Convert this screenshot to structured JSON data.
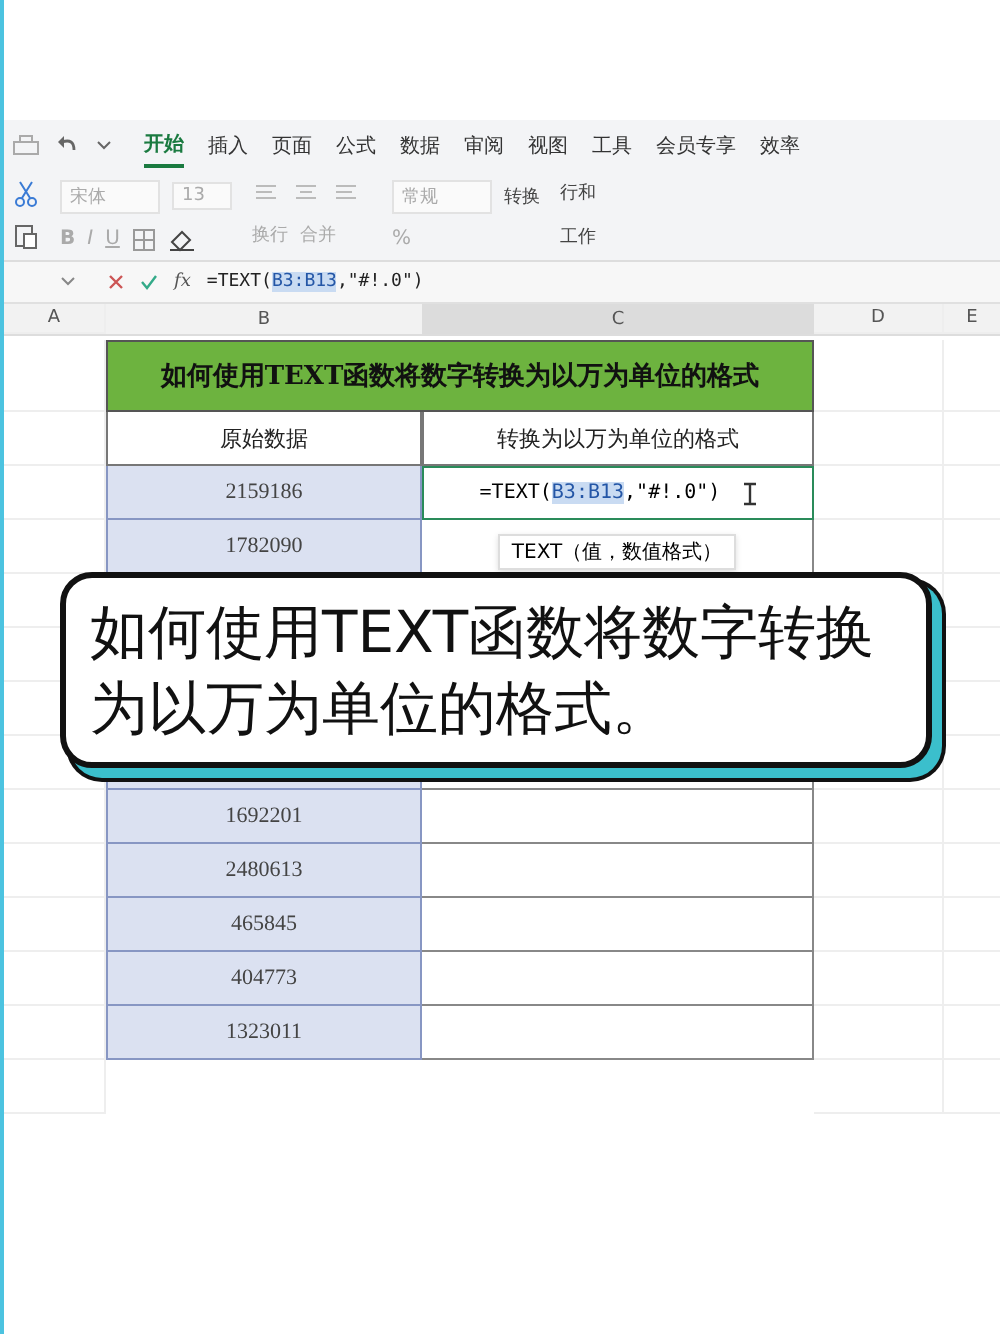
{
  "menu": {
    "tabs": [
      {
        "label": "开始",
        "selected": true
      },
      {
        "label": "插入",
        "selected": false
      },
      {
        "label": "页面",
        "selected": false
      },
      {
        "label": "公式",
        "selected": false
      },
      {
        "label": "数据",
        "selected": false
      },
      {
        "label": "审阅",
        "selected": false
      },
      {
        "label": "视图",
        "selected": false
      },
      {
        "label": "工具",
        "selected": false
      },
      {
        "label": "会员专享",
        "selected": false
      },
      {
        "label": "效率",
        "selected": false
      }
    ]
  },
  "ribbon": {
    "font": "宋体",
    "size": "13",
    "wrap": "换行",
    "merge": "合并",
    "format": "常规",
    "convert": "转换",
    "row_col": "行和",
    "sheet": "工作"
  },
  "text_style": {
    "bold": "B",
    "italic": "I",
    "underline": "U",
    "percent": "%"
  },
  "formula_bar": {
    "fx": "fx",
    "before": "=TEXT(",
    "ref": "B3:B13",
    "after": ",\"#!.0\")"
  },
  "columns": [
    "A",
    "B",
    "C",
    "D",
    "E"
  ],
  "table": {
    "title": "如何使用TEXT函数将数字转换为以万为单位的格式",
    "headers": [
      "原始数据",
      "转换为以万为单位的格式"
    ],
    "editing_cell": {
      "before": "=TEXT(",
      "ref": "B3:B13",
      "after": ",\"#!.0\")"
    },
    "tooltip": "TEXT（值，数值格式）",
    "top_values": [
      "2159186",
      "1782090"
    ],
    "bottom_values": [
      "1692201",
      "2480613",
      "465845",
      "404773",
      "1323011"
    ]
  },
  "callout": "如何使用TEXT函数将数字转换为以万为单位的格式。"
}
